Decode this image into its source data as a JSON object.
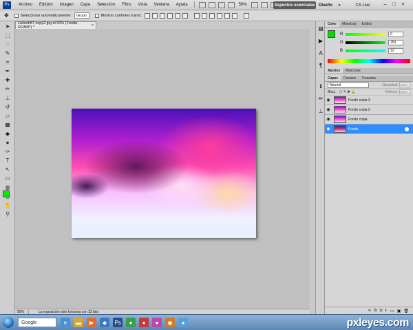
{
  "menu": [
    "Archivo",
    "Edición",
    "Imagen",
    "Capa",
    "Selección",
    "Filtro",
    "Vista",
    "Ventana",
    "Ayuda"
  ],
  "menubar": {
    "zoom": "50%",
    "workspace_essentials": "Aspectos esenciales",
    "workspace_design": "Diseño",
    "cs_live": "CS Live"
  },
  "options": {
    "auto_select": "Seleccionar automáticamente:",
    "auto_select_value": "Grupo",
    "show_transform": "Mostrar controles transf."
  },
  "document": {
    "tab_title": "Lizbeth87 copy2.jpg al 50% (Fondo, RGB/8*) *",
    "close": "×"
  },
  "status": {
    "zoom": "50%",
    "message": "La exposición sólo funciona con 32 bits"
  },
  "color_panel": {
    "tabs": [
      "Color",
      "Muestras",
      "Estilos"
    ],
    "fg_color": "#00dd00",
    "r": {
      "label": "R",
      "value": "0"
    },
    "g": {
      "label": "G",
      "value": "253"
    },
    "b": {
      "label": "B",
      "value": "12"
    }
  },
  "adjust_tabs": [
    "Ajustes",
    "Máscaras"
  ],
  "layers_tabs": [
    "Capas",
    "Canales",
    "Trazados"
  ],
  "layers": {
    "blend_mode": "Normal",
    "opacity_label": "Opacidad:",
    "opacity": "100%",
    "fill_label": "Relleno:",
    "fill": "100%",
    "lock_label": "Bloq.:",
    "items": [
      {
        "name": "Fondo copia 3",
        "active": false
      },
      {
        "name": "Fondo copia 2",
        "active": false
      },
      {
        "name": "Fondo copia",
        "active": false
      },
      {
        "name": "Fondo",
        "active": true
      }
    ]
  },
  "taskbar": {
    "search": "Google",
    "watermark": "pxleyes.com"
  },
  "icons": {
    "eye": "eye-icon",
    "move_tool": "move-tool-icon"
  }
}
